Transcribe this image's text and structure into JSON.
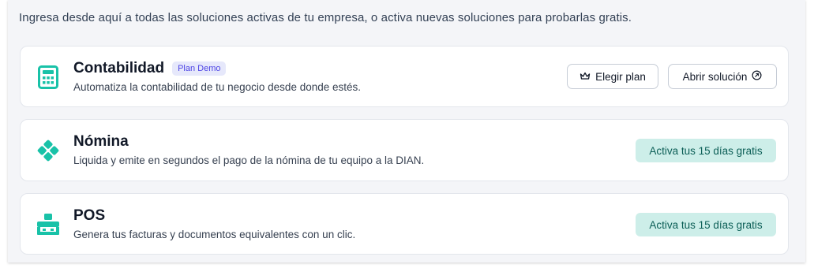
{
  "intro": "Ingresa desde aquí a todas las soluciones activas de tu empresa, o activa nuevas soluciones para probarlas gratis.",
  "accent": "#19c2a8",
  "solutions": [
    {
      "icon": "calculator-icon",
      "title": "Contabilidad",
      "badge": "Plan Demo",
      "description": "Automatiza la contabilidad de tu negocio desde donde estés.",
      "choose_plan_label": "Elegir plan",
      "open_label": "Abrir solución"
    },
    {
      "icon": "payroll-diamond-icon",
      "title": "Nómina",
      "description": "Liquida y emite en segundos el pago de la nómina de tu equipo a la DIAN.",
      "trial_label": "Activa tus 15 días gratis"
    },
    {
      "icon": "pos-register-icon",
      "title": "POS",
      "description": "Genera tus facturas y documentos equivalentes con un clic.",
      "trial_label": "Activa tus 15 días gratis"
    }
  ]
}
